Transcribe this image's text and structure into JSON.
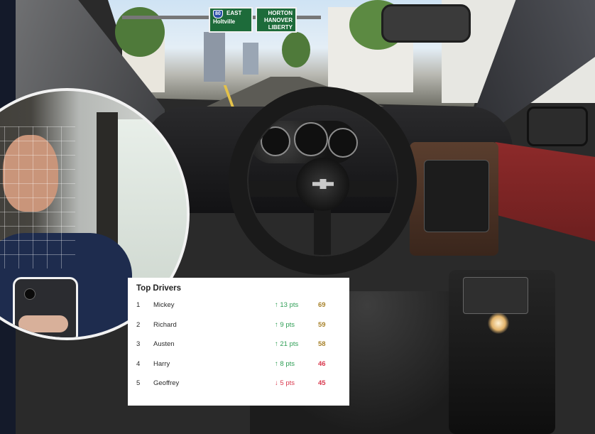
{
  "road_signs": {
    "left": {
      "route": "80",
      "direction": "EAST",
      "destination": "Holtville"
    },
    "right": {
      "line1": "HORTON",
      "line2": "HANOVER",
      "line3": "LIBERTY"
    }
  },
  "top_drivers": {
    "title": "Top Drivers",
    "rows": [
      {
        "rank": "1",
        "name": "Mickey",
        "delta": "13 pts",
        "trend": "up",
        "score": "69",
        "score_color": "gold"
      },
      {
        "rank": "2",
        "name": "Richard",
        "delta": "9 pts",
        "trend": "up",
        "score": "59",
        "score_color": "gold"
      },
      {
        "rank": "3",
        "name": "Austen",
        "delta": "21 pts",
        "trend": "up",
        "score": "58",
        "score_color": "gold"
      },
      {
        "rank": "4",
        "name": "Harry",
        "delta": "8 pts",
        "trend": "up",
        "score": "46",
        "score_color": "red"
      },
      {
        "rank": "5",
        "name": "Geoffrey",
        "delta": "5 pts",
        "trend": "down",
        "score": "45",
        "score_color": "red"
      }
    ]
  },
  "colors": {
    "up": "#2f9e55",
    "down": "#d9394e",
    "score_gold": "#a8832c",
    "score_red": "#d9394e"
  }
}
